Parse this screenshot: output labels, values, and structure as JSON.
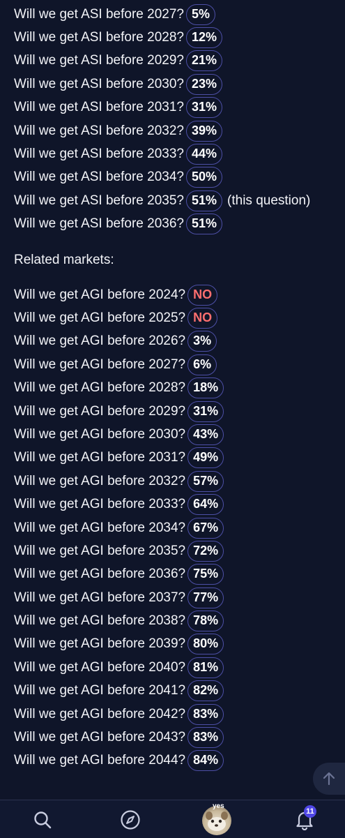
{
  "asi_markets": [
    {
      "question": "Will we get ASI before 2027?",
      "prob": "5%"
    },
    {
      "question": "Will we get ASI before 2028?",
      "prob": "12%"
    },
    {
      "question": "Will we get ASI before 2029?",
      "prob": "21%"
    },
    {
      "question": "Will we get ASI before 2030?",
      "prob": "23%"
    },
    {
      "question": "Will we get ASI before 2031?",
      "prob": "31%"
    },
    {
      "question": "Will we get ASI before 2032?",
      "prob": "39%"
    },
    {
      "question": "Will we get ASI before 2033?",
      "prob": "44%"
    },
    {
      "question": "Will we get ASI before 2034?",
      "prob": "50%"
    },
    {
      "question": "Will we get ASI before 2035?",
      "prob": "51%",
      "note": "(this question)"
    },
    {
      "question": "Will we get ASI before 2036?",
      "prob": "51%"
    }
  ],
  "related_heading": "Related markets:",
  "agi_markets": [
    {
      "question": "Will we get AGI before 2024?",
      "prob": "NO",
      "resolved": true
    },
    {
      "question": "Will we get AGI before 2025?",
      "prob": "NO",
      "resolved": true
    },
    {
      "question": "Will we get AGI before 2026?",
      "prob": "3%"
    },
    {
      "question": "Will we get AGI before 2027?",
      "prob": "6%"
    },
    {
      "question": "Will we get AGI before 2028?",
      "prob": "18%"
    },
    {
      "question": "Will we get AGI before 2029?",
      "prob": "31%"
    },
    {
      "question": "Will we get AGI before 2030?",
      "prob": "43%"
    },
    {
      "question": "Will we get AGI before 2031?",
      "prob": "49%"
    },
    {
      "question": "Will we get AGI before 2032?",
      "prob": "57%"
    },
    {
      "question": "Will we get AGI before 2033?",
      "prob": "64%"
    },
    {
      "question": "Will we get AGI before 2034?",
      "prob": "67%"
    },
    {
      "question": "Will we get AGI before 2035?",
      "prob": "72%"
    },
    {
      "question": "Will we get AGI before 2036?",
      "prob": "75%"
    },
    {
      "question": "Will we get AGI before 2037?",
      "prob": "77%"
    },
    {
      "question": "Will we get AGI before 2038?",
      "prob": "78%"
    },
    {
      "question": "Will we get AGI before 2039?",
      "prob": "80%"
    },
    {
      "question": "Will we get AGI before 2040?",
      "prob": "81%"
    },
    {
      "question": "Will we get AGI before 2041?",
      "prob": "82%"
    },
    {
      "question": "Will we get AGI before 2042?",
      "prob": "83%"
    },
    {
      "question": "Will we get AGI before 2043?",
      "prob": "83%"
    },
    {
      "question": "Will we get AGI before 2044?",
      "prob": "84%"
    }
  ],
  "bottom_nav": {
    "avatar_label": "yes",
    "notification_count": "11",
    "icons": [
      "search-icon",
      "compass-icon",
      "avatar",
      "bell-icon"
    ]
  },
  "colors": {
    "background": "#0f1529",
    "pill_border": "#4d4fa6",
    "resolved_no": "#ff6f6f",
    "badge": "#4f46e5"
  }
}
